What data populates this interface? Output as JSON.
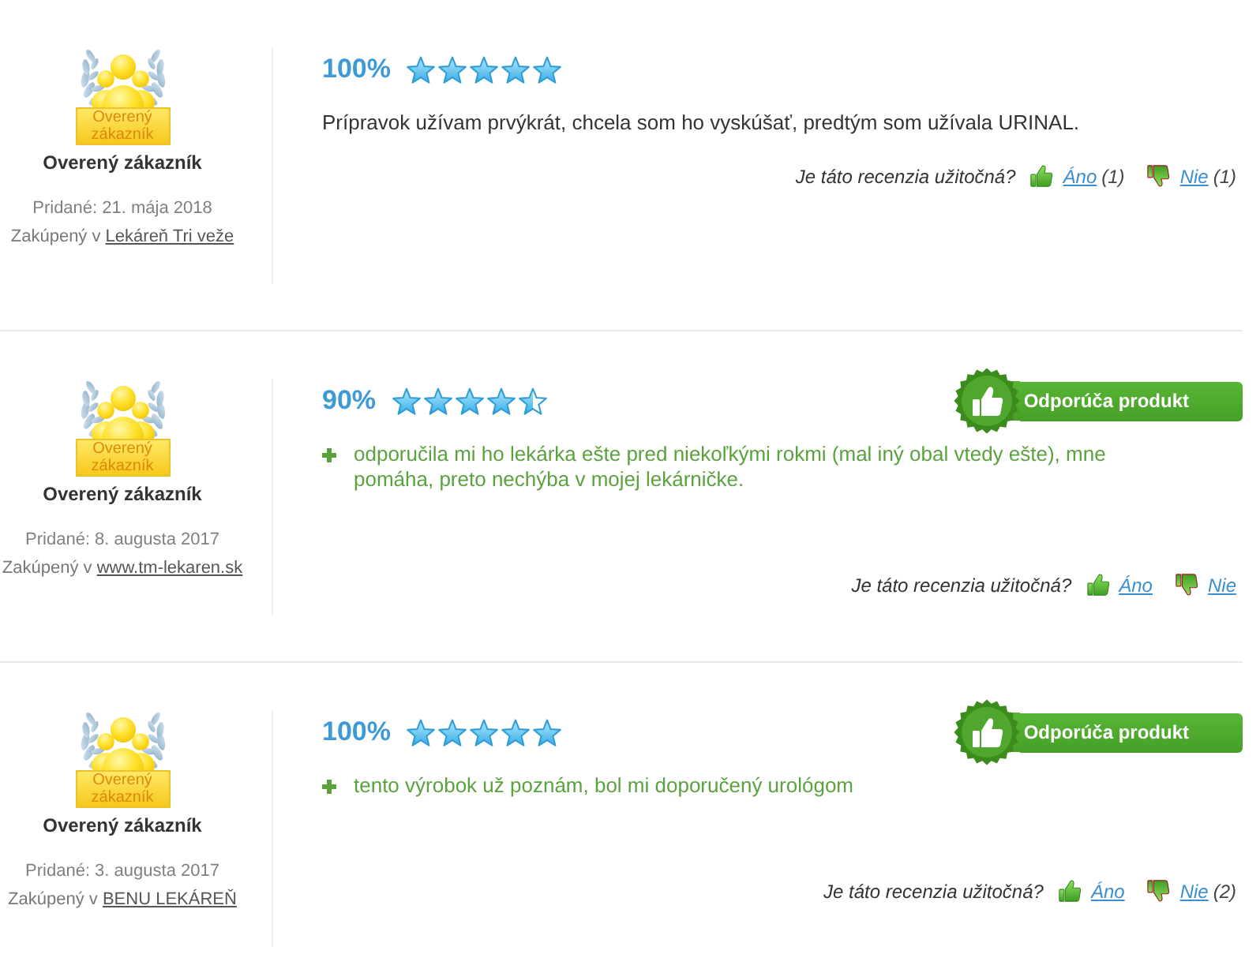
{
  "reviews": [
    {
      "customer": {
        "badge_label": "Overený zákazník",
        "name": "Overený zákazník",
        "added": "Pridané: 21. mája 2018",
        "purchased_prefix": "Zakúpený v",
        "store": "Lekáreň Tri veže"
      },
      "score": "100%",
      "stars": 5,
      "body": {
        "kind": "comment",
        "text": "Prípravok užívam prvýkrát, chcela som ho vyskúšať, predtým som užívala URINAL."
      },
      "helpful": {
        "question": "Je táto recenzia užitočná?",
        "yes": {
          "label": "Áno",
          "count": "(1)"
        },
        "no": {
          "label": "Nie",
          "count": "(1)"
        }
      }
    },
    {
      "customer": {
        "badge_label": "Overený zákazník",
        "name": "Overený zákazník",
        "added": "Pridané: 8. augusta 2017",
        "purchased_prefix": "Zakúpený v",
        "store": "www.tm-lekaren.sk"
      },
      "score": "90%",
      "stars": 4.5,
      "recommend_badge": "Odporúča produkt",
      "body": {
        "kind": "pro",
        "text": "odporučila mi ho lekárka ešte pred niekoľkými rokmi (mal iný obal vtedy ešte), mne pomáha, preto nechýba v mojej lekárničke."
      },
      "helpful": {
        "question": "Je táto recenzia užitočná?",
        "yes": {
          "label": "Áno"
        },
        "no": {
          "label": "Nie"
        }
      }
    },
    {
      "customer": {
        "badge_label": "Overený zákazník",
        "name": "Overený zákazník",
        "added": "Pridané: 3. augusta 2017",
        "purchased_prefix": "Zakúpený v",
        "store": "BENU LEKÁREŇ"
      },
      "score": "100%",
      "stars": 5,
      "recommend_badge": "Odporúča produkt",
      "body": {
        "kind": "pro",
        "text": "tento výrobok už poznám, bol mi doporučený urológom"
      },
      "helpful": {
        "question": "Je táto recenzia užitočná?",
        "yes": {
          "label": "Áno"
        },
        "no": {
          "label": "Nie",
          "count": "(2)"
        }
      }
    }
  ]
}
